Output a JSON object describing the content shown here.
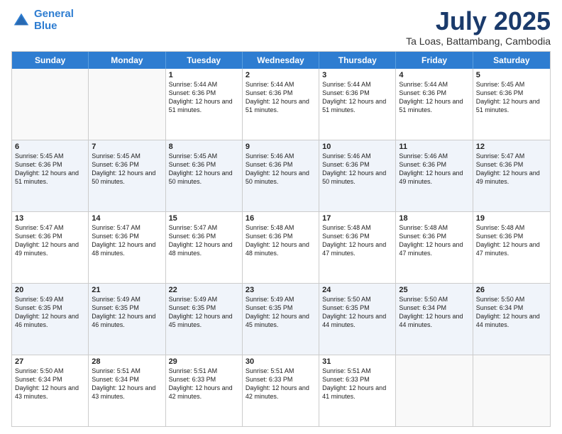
{
  "logo": {
    "line1": "General",
    "line2": "Blue"
  },
  "title": "July 2025",
  "subtitle": "Ta Loas, Battambang, Cambodia",
  "days": [
    "Sunday",
    "Monday",
    "Tuesday",
    "Wednesday",
    "Thursday",
    "Friday",
    "Saturday"
  ],
  "weeks": [
    [
      {
        "day": "",
        "info": ""
      },
      {
        "day": "",
        "info": ""
      },
      {
        "day": "1",
        "info": "Sunrise: 5:44 AM\nSunset: 6:36 PM\nDaylight: 12 hours and 51 minutes."
      },
      {
        "day": "2",
        "info": "Sunrise: 5:44 AM\nSunset: 6:36 PM\nDaylight: 12 hours and 51 minutes."
      },
      {
        "day": "3",
        "info": "Sunrise: 5:44 AM\nSunset: 6:36 PM\nDaylight: 12 hours and 51 minutes."
      },
      {
        "day": "4",
        "info": "Sunrise: 5:44 AM\nSunset: 6:36 PM\nDaylight: 12 hours and 51 minutes."
      },
      {
        "day": "5",
        "info": "Sunrise: 5:45 AM\nSunset: 6:36 PM\nDaylight: 12 hours and 51 minutes."
      }
    ],
    [
      {
        "day": "6",
        "info": "Sunrise: 5:45 AM\nSunset: 6:36 PM\nDaylight: 12 hours and 51 minutes."
      },
      {
        "day": "7",
        "info": "Sunrise: 5:45 AM\nSunset: 6:36 PM\nDaylight: 12 hours and 50 minutes."
      },
      {
        "day": "8",
        "info": "Sunrise: 5:45 AM\nSunset: 6:36 PM\nDaylight: 12 hours and 50 minutes."
      },
      {
        "day": "9",
        "info": "Sunrise: 5:46 AM\nSunset: 6:36 PM\nDaylight: 12 hours and 50 minutes."
      },
      {
        "day": "10",
        "info": "Sunrise: 5:46 AM\nSunset: 6:36 PM\nDaylight: 12 hours and 50 minutes."
      },
      {
        "day": "11",
        "info": "Sunrise: 5:46 AM\nSunset: 6:36 PM\nDaylight: 12 hours and 49 minutes."
      },
      {
        "day": "12",
        "info": "Sunrise: 5:47 AM\nSunset: 6:36 PM\nDaylight: 12 hours and 49 minutes."
      }
    ],
    [
      {
        "day": "13",
        "info": "Sunrise: 5:47 AM\nSunset: 6:36 PM\nDaylight: 12 hours and 49 minutes."
      },
      {
        "day": "14",
        "info": "Sunrise: 5:47 AM\nSunset: 6:36 PM\nDaylight: 12 hours and 48 minutes."
      },
      {
        "day": "15",
        "info": "Sunrise: 5:47 AM\nSunset: 6:36 PM\nDaylight: 12 hours and 48 minutes."
      },
      {
        "day": "16",
        "info": "Sunrise: 5:48 AM\nSunset: 6:36 PM\nDaylight: 12 hours and 48 minutes."
      },
      {
        "day": "17",
        "info": "Sunrise: 5:48 AM\nSunset: 6:36 PM\nDaylight: 12 hours and 47 minutes."
      },
      {
        "day": "18",
        "info": "Sunrise: 5:48 AM\nSunset: 6:36 PM\nDaylight: 12 hours and 47 minutes."
      },
      {
        "day": "19",
        "info": "Sunrise: 5:48 AM\nSunset: 6:36 PM\nDaylight: 12 hours and 47 minutes."
      }
    ],
    [
      {
        "day": "20",
        "info": "Sunrise: 5:49 AM\nSunset: 6:35 PM\nDaylight: 12 hours and 46 minutes."
      },
      {
        "day": "21",
        "info": "Sunrise: 5:49 AM\nSunset: 6:35 PM\nDaylight: 12 hours and 46 minutes."
      },
      {
        "day": "22",
        "info": "Sunrise: 5:49 AM\nSunset: 6:35 PM\nDaylight: 12 hours and 45 minutes."
      },
      {
        "day": "23",
        "info": "Sunrise: 5:49 AM\nSunset: 6:35 PM\nDaylight: 12 hours and 45 minutes."
      },
      {
        "day": "24",
        "info": "Sunrise: 5:50 AM\nSunset: 6:35 PM\nDaylight: 12 hours and 44 minutes."
      },
      {
        "day": "25",
        "info": "Sunrise: 5:50 AM\nSunset: 6:34 PM\nDaylight: 12 hours and 44 minutes."
      },
      {
        "day": "26",
        "info": "Sunrise: 5:50 AM\nSunset: 6:34 PM\nDaylight: 12 hours and 44 minutes."
      }
    ],
    [
      {
        "day": "27",
        "info": "Sunrise: 5:50 AM\nSunset: 6:34 PM\nDaylight: 12 hours and 43 minutes."
      },
      {
        "day": "28",
        "info": "Sunrise: 5:51 AM\nSunset: 6:34 PM\nDaylight: 12 hours and 43 minutes."
      },
      {
        "day": "29",
        "info": "Sunrise: 5:51 AM\nSunset: 6:33 PM\nDaylight: 12 hours and 42 minutes."
      },
      {
        "day": "30",
        "info": "Sunrise: 5:51 AM\nSunset: 6:33 PM\nDaylight: 12 hours and 42 minutes."
      },
      {
        "day": "31",
        "info": "Sunrise: 5:51 AM\nSunset: 6:33 PM\nDaylight: 12 hours and 41 minutes."
      },
      {
        "day": "",
        "info": ""
      },
      {
        "day": "",
        "info": ""
      }
    ]
  ]
}
